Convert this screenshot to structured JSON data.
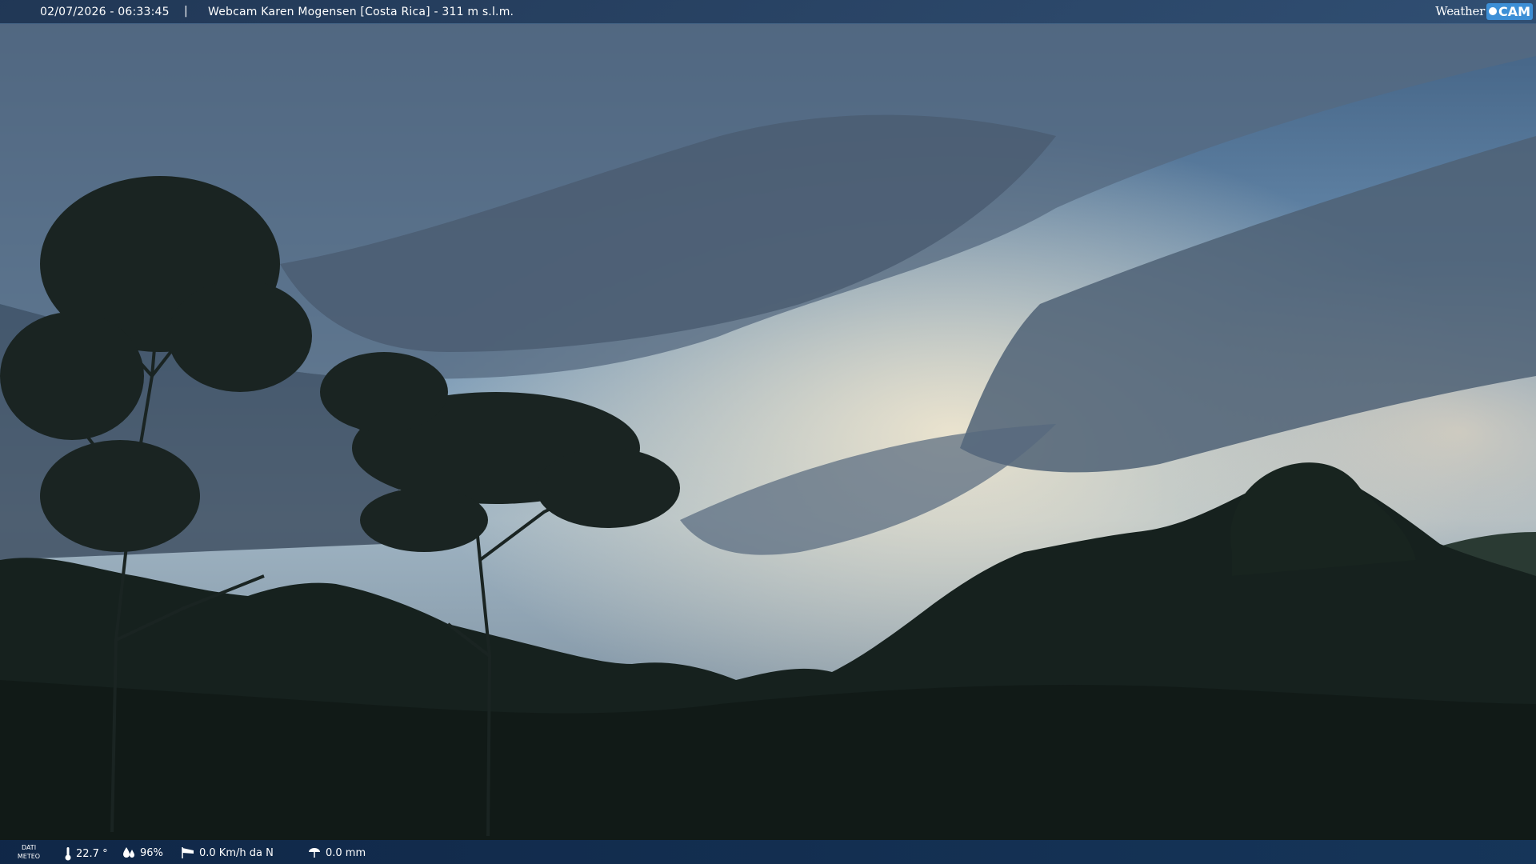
{
  "header": {
    "datetime": "02/07/2026 - 06:33:45",
    "separator": "|",
    "title": "Webcam Karen Mogensen [Costa Rica]  - 311 m s.l.m."
  },
  "logo": {
    "weather": "Weather",
    "cam": "CAM"
  },
  "footer": {
    "label_line1": "DATI",
    "label_line2": "METEO",
    "temperature": "22.7 °",
    "humidity": "96%",
    "wind": "0.0 Km/h da N",
    "rain": "0.0 mm"
  },
  "icons": {
    "temperature": "thermometer-icon",
    "humidity": "humidity-drops-icon",
    "wind": "wind-sock-icon",
    "rain": "rain-gauge-icon"
  },
  "colors": {
    "sky_top": "#4f6c8a",
    "sky_bright": "#d8dccd",
    "forest": "#141f1c",
    "bar_blue": "#1c3c66"
  }
}
